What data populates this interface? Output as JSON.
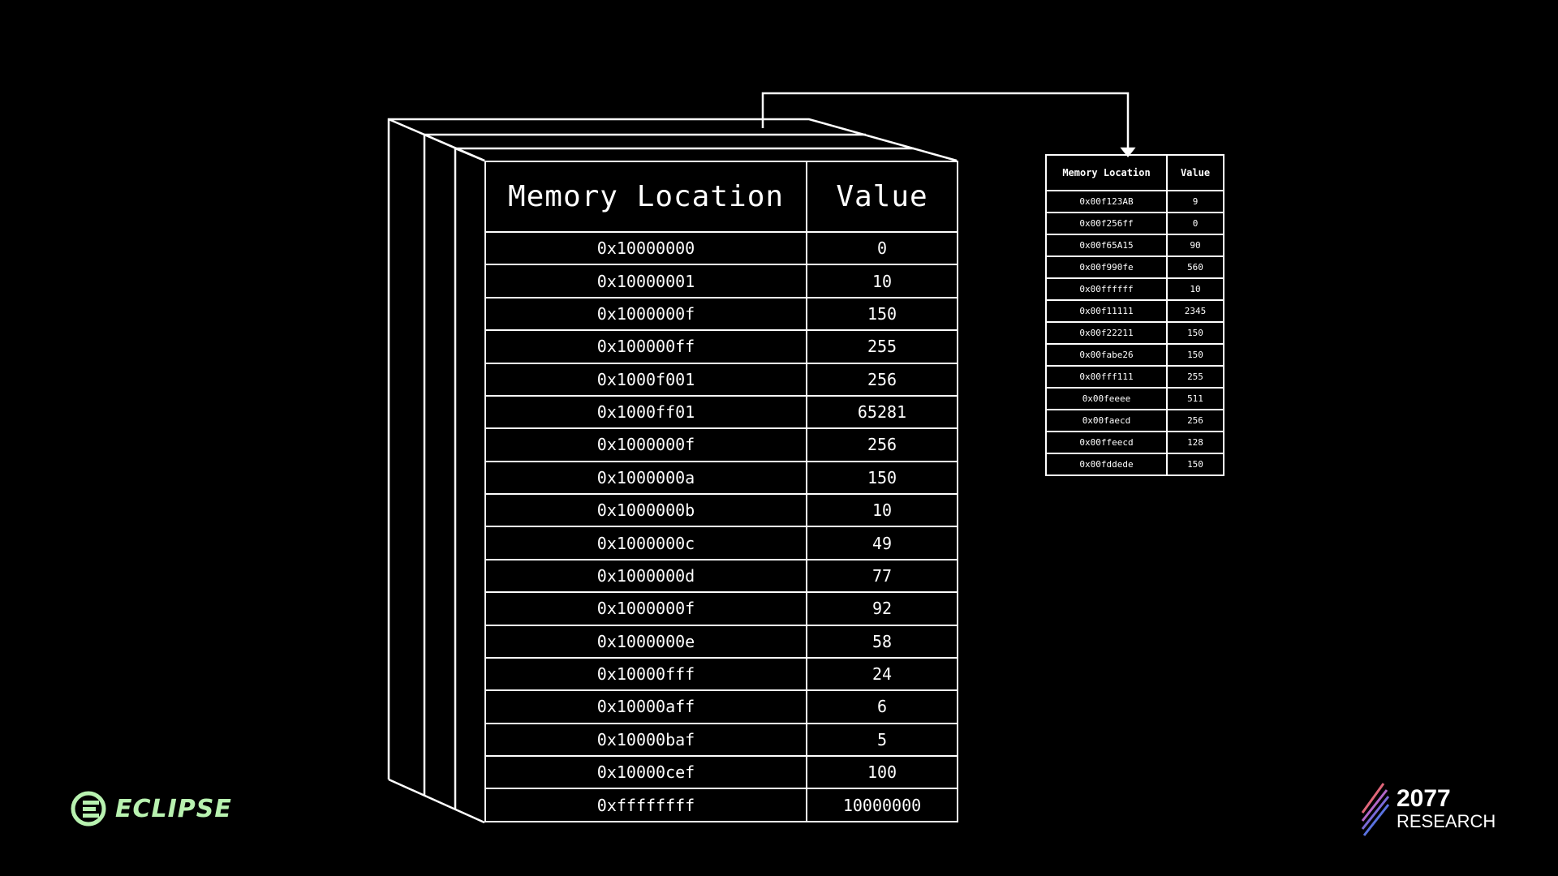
{
  "main_table": {
    "header": {
      "location": "Memory Location",
      "value": "Value"
    },
    "rows": [
      {
        "location": "0x10000000",
        "value": "0"
      },
      {
        "location": "0x10000001",
        "value": "10"
      },
      {
        "location": "0x1000000f",
        "value": "150"
      },
      {
        "location": "0x100000ff",
        "value": "255"
      },
      {
        "location": "0x1000f001",
        "value": "256"
      },
      {
        "location": "0x1000ff01",
        "value": "65281"
      },
      {
        "location": "0x1000000f",
        "value": "256"
      },
      {
        "location": "0x1000000a",
        "value": "150"
      },
      {
        "location": "0x1000000b",
        "value": "10"
      },
      {
        "location": "0x1000000c",
        "value": "49"
      },
      {
        "location": "0x1000000d",
        "value": "77"
      },
      {
        "location": "0x1000000f",
        "value": "92"
      },
      {
        "location": "0x1000000e",
        "value": "58"
      },
      {
        "location": "0x10000fff",
        "value": "24"
      },
      {
        "location": "0x10000aff",
        "value": "6"
      },
      {
        "location": "0x10000baf",
        "value": "5"
      },
      {
        "location": "0x10000cef",
        "value": "100"
      },
      {
        "location": "0xffffffff",
        "value": "10000000"
      }
    ]
  },
  "small_table": {
    "header": {
      "location": "Memory Location",
      "value": "Value"
    },
    "rows": [
      {
        "location": "0x00f123AB",
        "value": "9"
      },
      {
        "location": "0x00f256ff",
        "value": "0"
      },
      {
        "location": "0x00f65A15",
        "value": "90"
      },
      {
        "location": "0x00f990fe",
        "value": "560"
      },
      {
        "location": "0x00ffffff",
        "value": "10"
      },
      {
        "location": "0x00f11111",
        "value": "2345"
      },
      {
        "location": "0x00f22211",
        "value": "150"
      },
      {
        "location": "0x00fabe26",
        "value": "150"
      },
      {
        "location": "0x00fff111",
        "value": "255"
      },
      {
        "location": "0x00feeee",
        "value": "511"
      },
      {
        "location": "0x00faecd",
        "value": "256"
      },
      {
        "location": "0x00ffeecd",
        "value": "128"
      },
      {
        "location": "0x00fddede",
        "value": "150"
      }
    ]
  },
  "brand_left": {
    "name": "ECLIPSE",
    "icon": "eclipse-logo-icon",
    "color": "#b8f2b0"
  },
  "brand_right": {
    "number": "2077",
    "subtitle": "RESEARCH",
    "icon": "stripes-logo-icon"
  }
}
